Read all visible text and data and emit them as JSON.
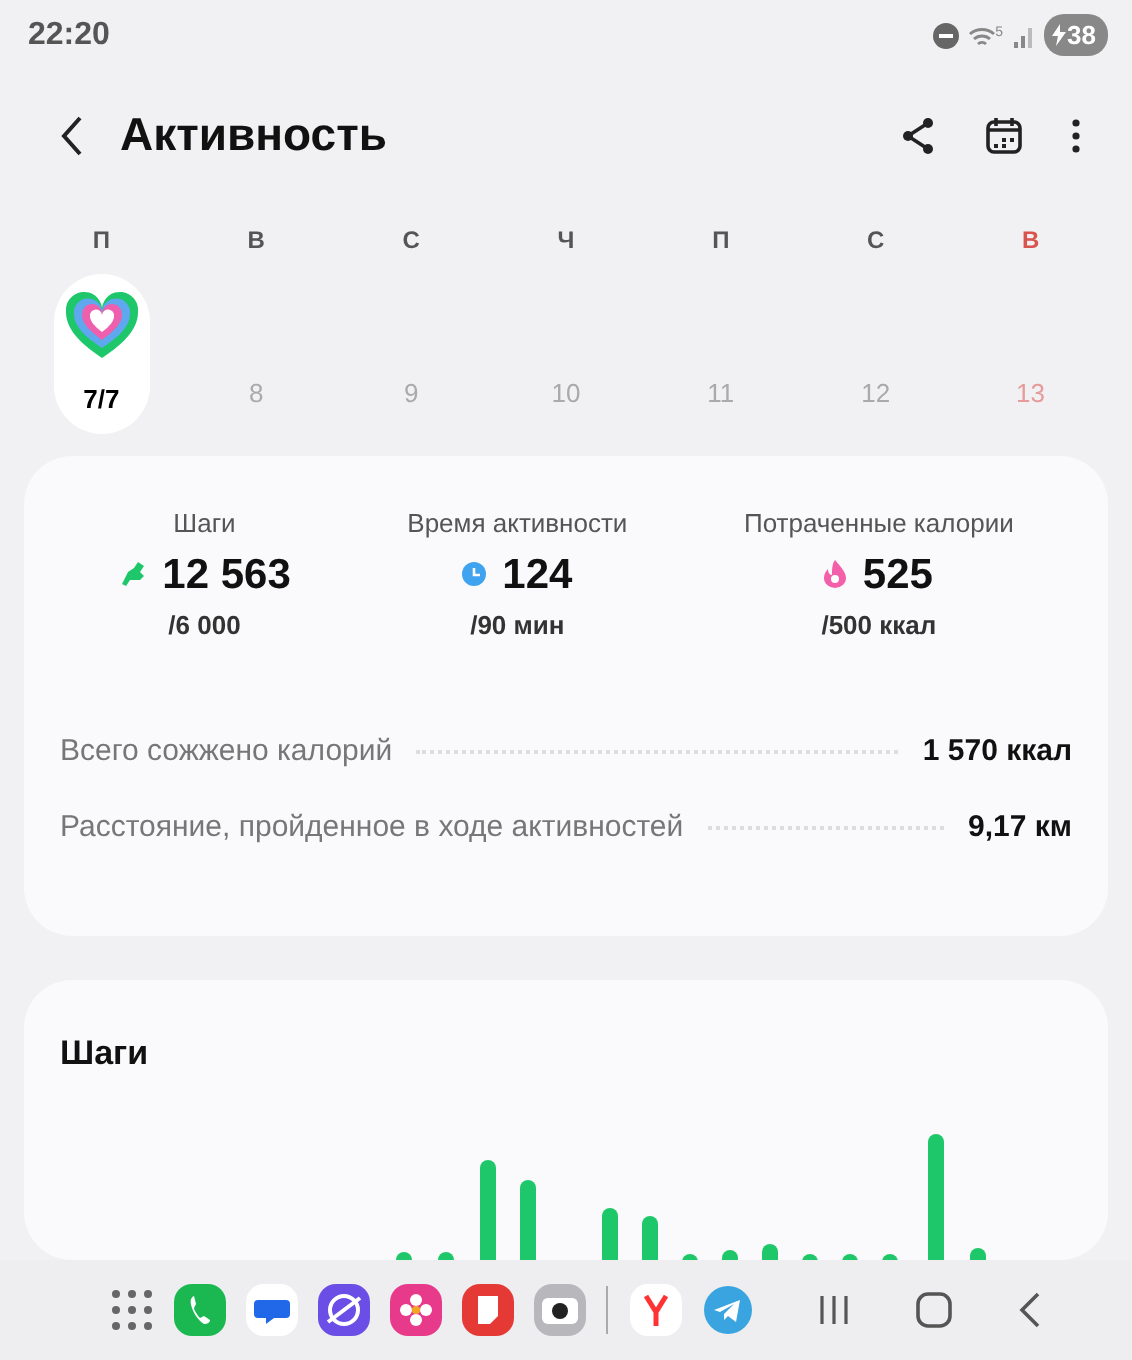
{
  "status_bar": {
    "time": "22:20",
    "wifi_label": "5",
    "battery": "38"
  },
  "header": {
    "title": "Активность"
  },
  "week": [
    {
      "letter": "П",
      "kind": "goal",
      "text": "7/7",
      "weekend": false,
      "selected": true
    },
    {
      "letter": "В",
      "kind": "date",
      "text": "8",
      "weekend": false,
      "selected": false
    },
    {
      "letter": "С",
      "kind": "date",
      "text": "9",
      "weekend": false,
      "selected": false
    },
    {
      "letter": "Ч",
      "kind": "date",
      "text": "10",
      "weekend": false,
      "selected": false
    },
    {
      "letter": "П",
      "kind": "date",
      "text": "11",
      "weekend": false,
      "selected": false
    },
    {
      "letter": "С",
      "kind": "date",
      "text": "12",
      "weekend": false,
      "selected": false
    },
    {
      "letter": "В",
      "kind": "date",
      "text": "13",
      "weekend": true,
      "selected": false
    }
  ],
  "stats": [
    {
      "kind": "steps",
      "label": "Шаги",
      "value": "12 563",
      "target": "/6 000",
      "color": "#1ec86a"
    },
    {
      "kind": "time",
      "label": "Время активности",
      "value": "124",
      "target": "/90 мин",
      "color": "#3fa3f0"
    },
    {
      "kind": "calories",
      "label": "Потраченные калории",
      "value": "525",
      "target": "/500 ккал",
      "color": "#f35fa8"
    }
  ],
  "summary": [
    {
      "label": "Всего сожжено калорий",
      "value": "1 570 ккал"
    },
    {
      "label": "Расстояние, пройденное в ходе активностей",
      "value": "9,17 км"
    }
  ],
  "steps_card": {
    "title": "Шаги"
  },
  "dock": [
    {
      "kind": "apps"
    },
    {
      "kind": "phone"
    },
    {
      "kind": "messages"
    },
    {
      "kind": "browser"
    },
    {
      "kind": "gallery"
    },
    {
      "kind": "notes"
    },
    {
      "kind": "camera"
    },
    {
      "kind": "divider"
    },
    {
      "kind": "yandex"
    },
    {
      "kind": "telegram"
    },
    {
      "kind": "recents"
    },
    {
      "kind": "home"
    },
    {
      "kind": "back"
    }
  ]
}
